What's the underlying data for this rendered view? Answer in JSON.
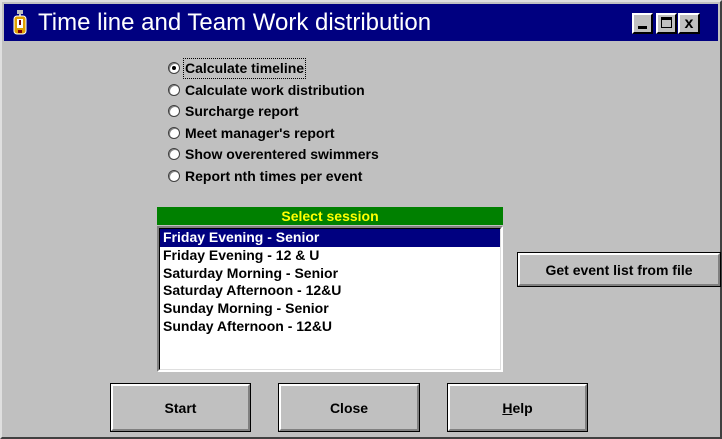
{
  "window": {
    "title": "Time line and Team Work distribution",
    "controls": {
      "minimize": "_",
      "maximize": "□",
      "close": "x"
    }
  },
  "options": [
    {
      "label": "Calculate timeline",
      "checked": true
    },
    {
      "label": "Calculate work distribution",
      "checked": false
    },
    {
      "label": "Surcharge report",
      "checked": false
    },
    {
      "label": "Meet manager's report",
      "checked": false
    },
    {
      "label": "Show overentered swimmers",
      "checked": false
    },
    {
      "label": "Report nth times per event",
      "checked": false
    }
  ],
  "session": {
    "header": "Select session",
    "items": [
      {
        "label": "Friday Evening - Senior",
        "selected": true
      },
      {
        "label": "Friday Evening - 12 & U",
        "selected": false
      },
      {
        "label": "Saturday Morning - Senior",
        "selected": false
      },
      {
        "label": "Saturday Afternoon - 12&U",
        "selected": false
      },
      {
        "label": "Sunday Morning - Senior",
        "selected": false
      },
      {
        "label": "Sunday Afternoon - 12&U",
        "selected": false
      }
    ]
  },
  "buttons": {
    "get_event_list": "Get event list from file",
    "start": "Start",
    "close": "Close",
    "help_mnemonic": "H",
    "help_rest": "elp"
  },
  "colors": {
    "titlebar": "#000080",
    "session_header_bg": "#008000",
    "session_header_text": "#ffff00",
    "selection": "#000080",
    "window_bg": "#c0c0c0"
  }
}
